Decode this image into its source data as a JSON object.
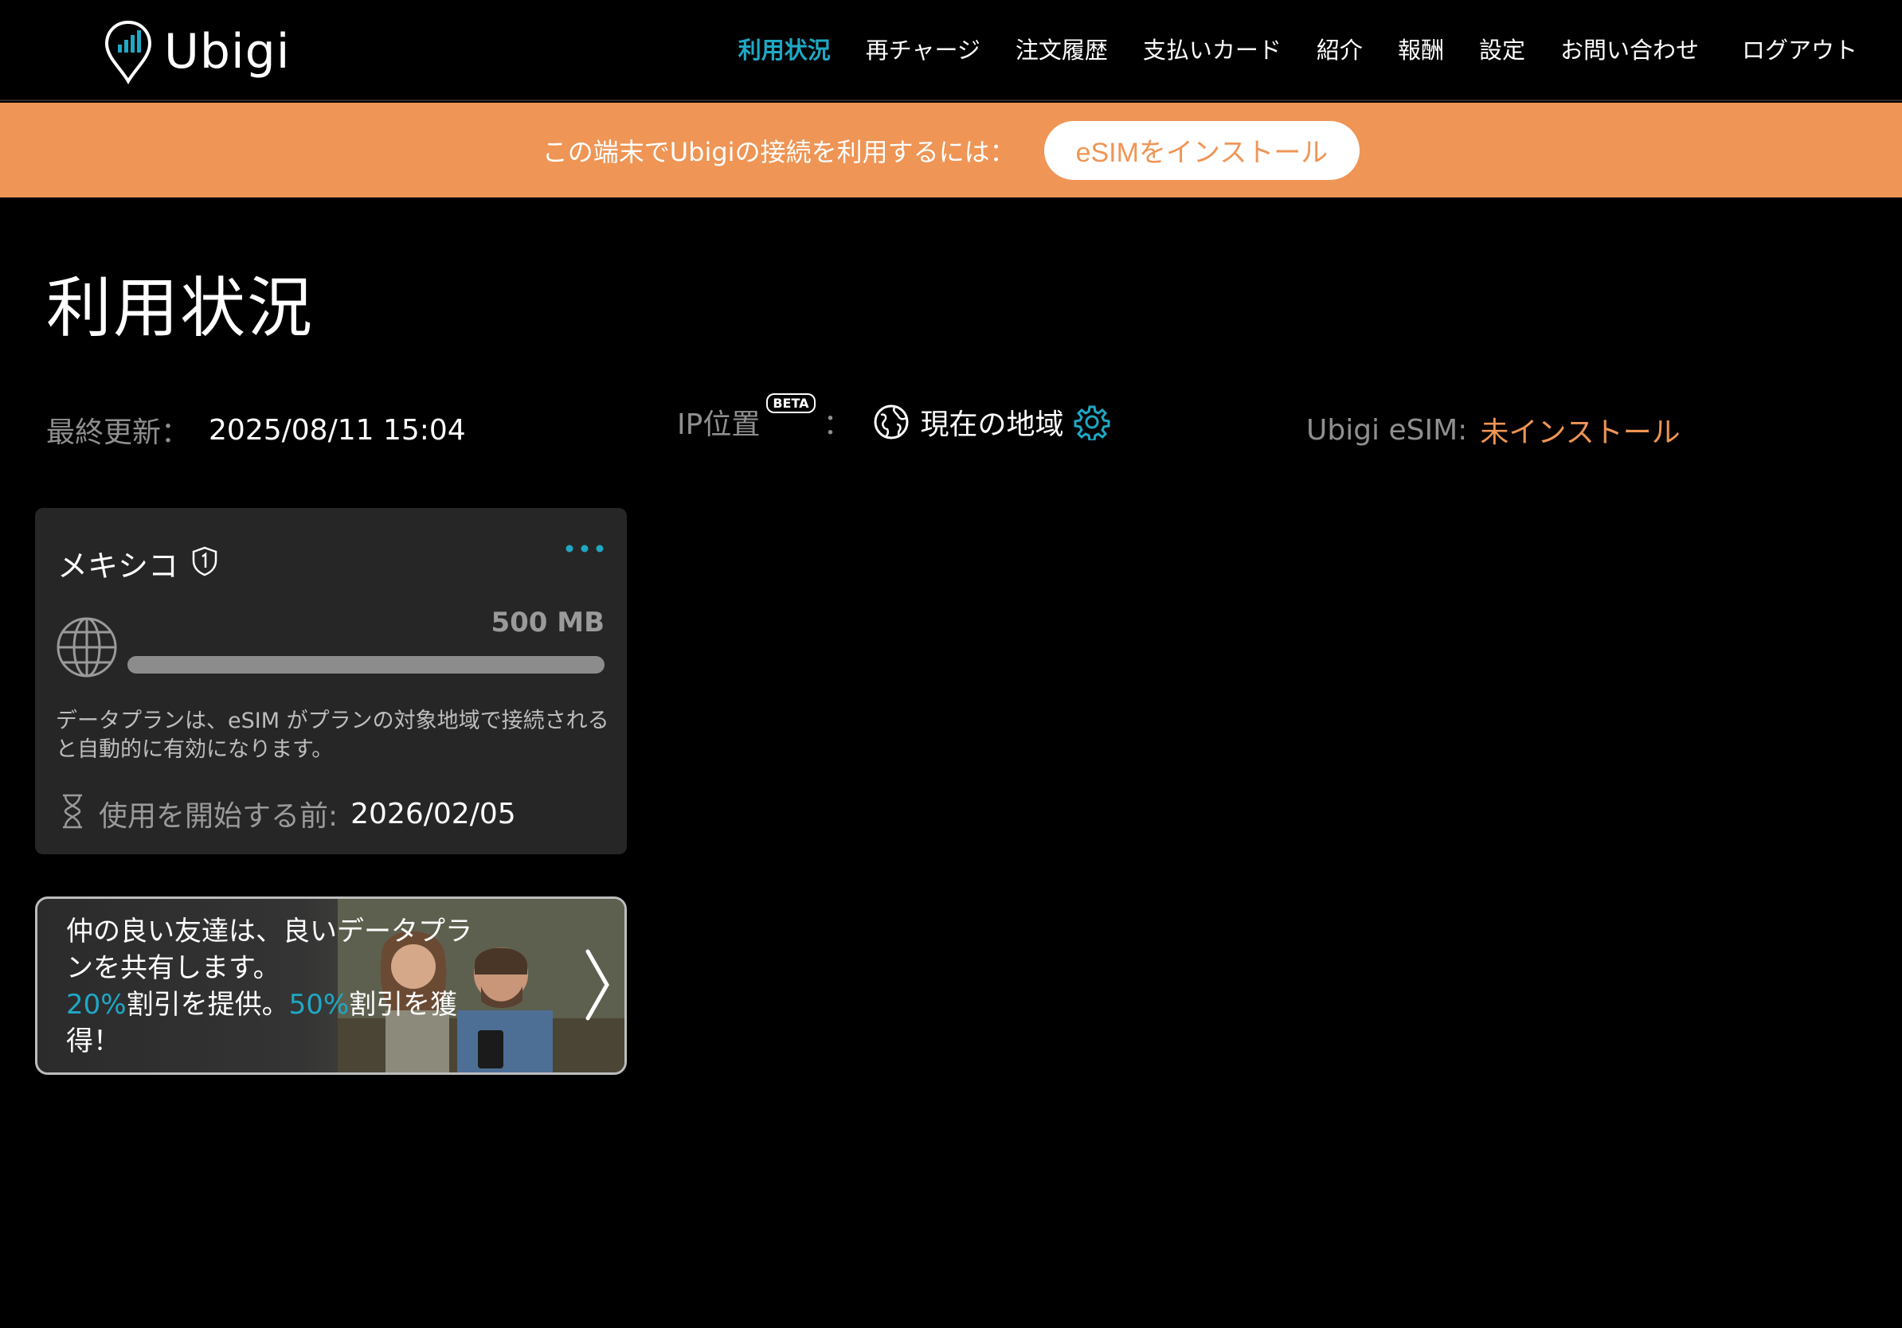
{
  "header": {
    "logo_text": "Ubigi",
    "nav": [
      {
        "label": "利用状況",
        "active": true
      },
      {
        "label": "再チャージ"
      },
      {
        "label": "注文履歴"
      },
      {
        "label": "支払いカード"
      },
      {
        "label": "紹介"
      },
      {
        "label": "報酬"
      },
      {
        "label": "設定"
      },
      {
        "label": "お問い合わせ"
      },
      {
        "label": "ログアウト"
      }
    ]
  },
  "banner": {
    "text": "この端末でUbigiの接続を利用するには：",
    "button_label": "eSIMをインストール"
  },
  "page_title": "利用状況",
  "status": {
    "updated_label": "最終更新：",
    "updated_value": "2025/08/11 15:04",
    "ip_label": "IP位置",
    "ip_badge": "BETA",
    "ip_colon": "：",
    "ip_value": "現在の地域",
    "esim_label": "Ubigi eSIM:",
    "esim_value": "未インストール"
  },
  "plan": {
    "country": "メキシコ",
    "amount": "500 MB",
    "note": "データプランは、eSIM がプランの対象地域で接続されると自動的に有効になります。",
    "start_label": "使用を開始する前:",
    "start_value": "2026/02/05"
  },
  "promo": {
    "line1": "仲の良い友達は、良いデータプランを共有します。",
    "pct1": "20%",
    "mid": "割引を提供。",
    "pct2": "50%",
    "end": "割引を獲得！"
  },
  "colors": {
    "accent_teal": "#1fa8c4",
    "accent_orange": "#ef9555",
    "card_bg": "#262626"
  }
}
